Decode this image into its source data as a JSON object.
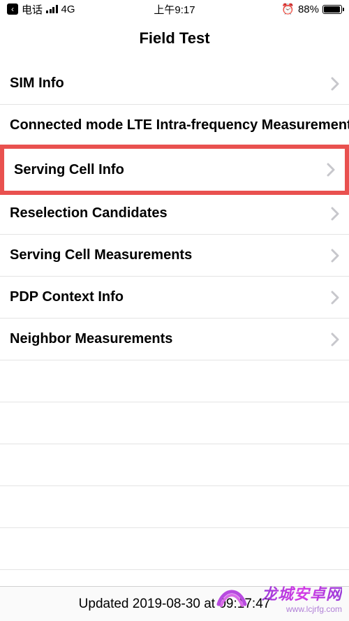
{
  "status": {
    "back_label": "电话",
    "back_glyph": "‹",
    "network": "4G",
    "time": "上午9:17",
    "alarm_glyph": "⏰",
    "battery_pct": "88%"
  },
  "nav": {
    "title": "Field Test"
  },
  "rows": [
    {
      "label": "SIM Info",
      "highlighted": false
    },
    {
      "label": "Connected mode LTE Intra-frequency Measurements",
      "highlighted": false
    },
    {
      "label": "Serving Cell Info",
      "highlighted": true
    },
    {
      "label": "Reselection Candidates",
      "highlighted": false
    },
    {
      "label": "Serving Cell Measurements",
      "highlighted": false
    },
    {
      "label": "PDP Context Info",
      "highlighted": false
    },
    {
      "label": "Neighbor Measurements",
      "highlighted": false
    }
  ],
  "footer": {
    "updated": "Updated 2019-08-30 at 09:17:47"
  },
  "watermark": {
    "main": "龙城安卓网",
    "sub": "www.lcjrfg.com"
  }
}
